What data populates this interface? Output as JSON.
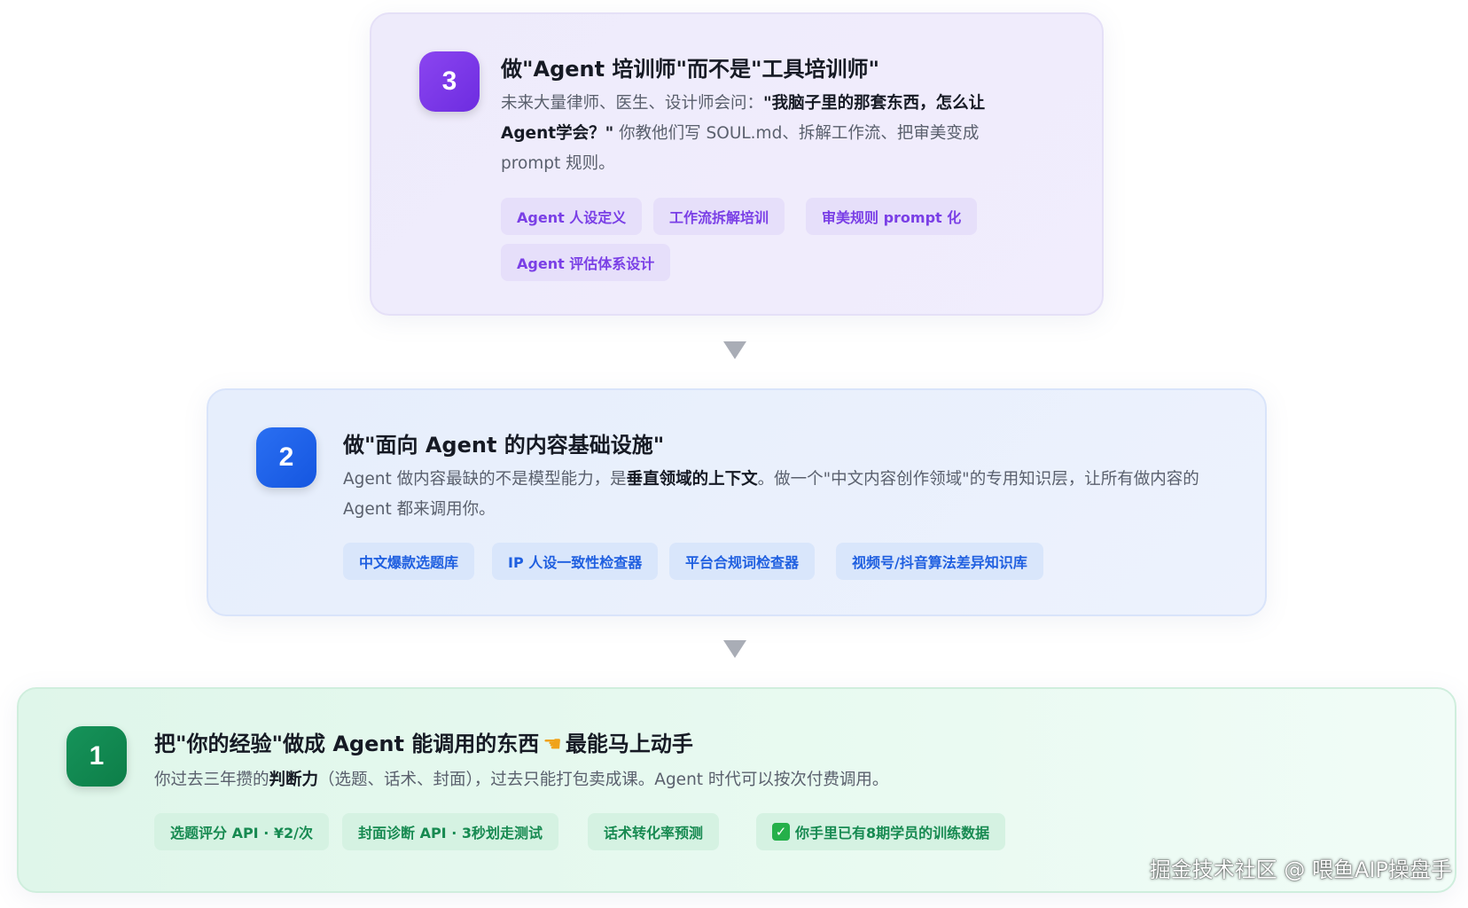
{
  "cards": [
    {
      "number": "3",
      "title": "做\"Agent 培训师\"而不是\"工具培训师\"",
      "desc_prefix": "未来大量律师、医生、设计师会问：",
      "desc_bold": "\"我脑子里的那套东西，怎么让 Agent学会？\"",
      "desc_suffix": " 你教他们写 SOUL.md、拆解工作流、把审美变成 prompt 规则。",
      "tags": [
        "Agent 人设定义",
        "工作流拆解培训",
        "审美规则 prompt 化",
        "Agent 评估体系设计"
      ],
      "accent": "#7a3fe6"
    },
    {
      "number": "2",
      "title": "做\"面向 Agent 的内容基础设施\"",
      "desc_prefix": "Agent 做内容最缺的不是模型能力，是",
      "desc_bold": "垂直领域的上下文",
      "desc_suffix": "。做一个\"中文内容创作领域\"的专用知识层，让所有做内容的 Agent 都来调用你。",
      "tags": [
        "中文爆款选题库",
        "IP 人设一致性检查器",
        "平台合规词检查器",
        "视频号/抖音算法差异知识库"
      ],
      "accent": "#1f5fe0"
    },
    {
      "number": "1",
      "title_prefix": "把\"你的经验\"做成 Agent 能调用的东西",
      "title_suffix": "最能马上动手",
      "hand_icon": "hand-pointing-left-icon",
      "desc_prefix": "你过去三年攒的",
      "desc_bold": "判断力",
      "desc_suffix": "（选题、话术、封面），过去只能打包卖成课。Agent 时代可以按次付费调用。",
      "tags": [
        "选题评分 API · ¥2/次",
        "封面诊断 API · 3秒划走测试",
        "话术转化率预测",
        "你手里已有8期学员的训练数据"
      ],
      "accent": "#178a51"
    }
  ],
  "watermark": "掘金技术社区 @ 喂鱼AIP操盘手"
}
